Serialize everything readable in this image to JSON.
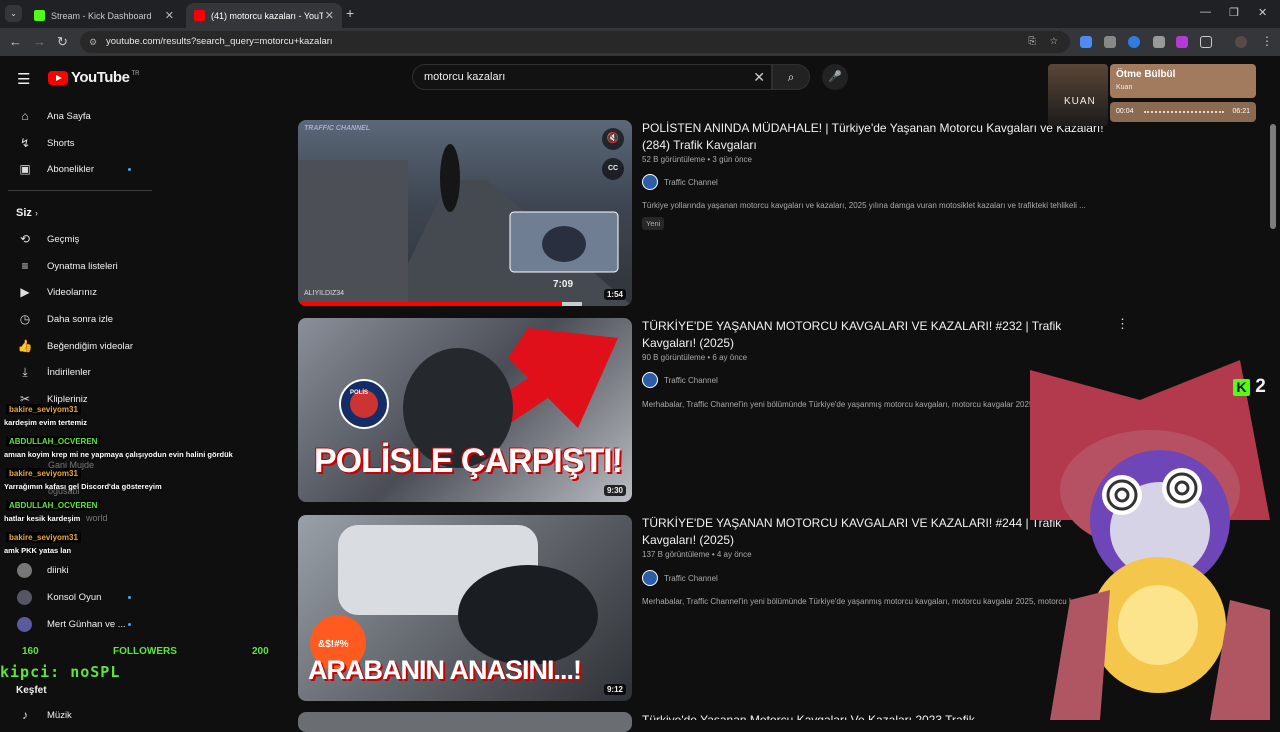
{
  "browser": {
    "tabs": [
      {
        "title": "Stream - Kick Dashboard"
      },
      {
        "title": "(41) motorcu kazaları - YouTube"
      }
    ],
    "url": "youtube.com/results?search_query=motorcu+kazaları"
  },
  "youtube": {
    "logo": "YouTube",
    "logo_suffix": "TR",
    "search_query": "motorcu kazaları",
    "sidebar": {
      "main": [
        {
          "label": "Ana Sayfa",
          "icon": "home-icon"
        },
        {
          "label": "Shorts",
          "icon": "shorts-icon"
        },
        {
          "label": "Abonelikler",
          "icon": "subscriptions-icon"
        }
      ],
      "you_header": "Siz",
      "you": [
        {
          "label": "Geçmiş",
          "icon": "history-icon"
        },
        {
          "label": "Oynatma listeleri",
          "icon": "playlists-icon"
        },
        {
          "label": "Videolarınız",
          "icon": "your-videos-icon"
        },
        {
          "label": "Daha sonra izle",
          "icon": "watch-later-icon"
        },
        {
          "label": "Beğendiğim videolar",
          "icon": "liked-icon"
        },
        {
          "label": "İndirilenler",
          "icon": "downloads-icon"
        },
        {
          "label": "Klipleriniz",
          "icon": "clips-icon"
        }
      ],
      "subs": [
        {
          "label": "diinki"
        },
        {
          "label": "Konsol Oyun"
        },
        {
          "label": "Mert Günhan ve ..."
        }
      ],
      "subs_partial": [
        "Gani Mujde",
        "ogusabi",
        "world"
      ],
      "explore_header": "Keşfet",
      "explore": [
        {
          "label": "Müzik"
        }
      ]
    },
    "results": [
      {
        "title": "POLİSTEN ANINDA MÜDAHALE! | Türkiye'de Yaşanan Motorcu Kavgaları ve Kazaları! (284) Trafik Kavgaları",
        "views": "52 B görüntüleme",
        "age": "3 gün önce",
        "channel": "Traffic Channel",
        "desc": "Türkiye yollarında yaşanan motorcu kavgaları ve kazaları, 2025 yılına damga vuran motosiklet kazaları ve trafikteki tehlikeli ...",
        "badge": "Yeni",
        "duration": "1:54",
        "preview_time": "7:09",
        "thumb_brand": "TRAFFIC CHANNEL",
        "thumb_handle": "ALIYILDIZ34"
      },
      {
        "title": "TÜRKİYE'DE YAŞANAN MOTORCU KAVGALARI VE KAZALARI! #232 | Trafik Kavgaları! (2025)",
        "views": "90 B görüntüleme",
        "age": "6 ay önce",
        "channel": "Traffic Channel",
        "desc": "Merhabalar, Traffic Channel'in yeni bölümünde Türkiye'de yaşanmış motorcu kavgaları, motorcu kavgalar 2025,",
        "duration": "9:30",
        "thumb_text": "POLİSLE ÇARPIŞTI!",
        "thumb_badge": "POLİS"
      },
      {
        "title": "TÜRKİYE'DE YAŞANAN MOTORCU KAVGALARI VE KAZALARI! #244 | Trafik Kavgaları! (2025)",
        "views": "137 B görüntüleme",
        "age": "4 ay önce",
        "channel": "Traffic Channel",
        "desc": "Merhabalar, Traffic Channel'in yeni bölümünde Türkiye'de yaşanmış motorcu kavgaları, motorcu kavgalar 2025, motorcu k",
        "duration": "9:12",
        "thumb_text": "ARABANIN ANASINI...!",
        "thumb_emoji_text": "&$!#%"
      },
      {
        "title": "Türkiye'de Yaşanan Motorcu Kavgaları Ve Kazaları 2023 Trafik"
      }
    ]
  },
  "overlay": {
    "chat": [
      {
        "name": "bakire_seviyom31",
        "msg": "kardeşim evim tertemiz",
        "color": "#f0a830"
      },
      {
        "name": "ABDULLAH_OCVEREN",
        "msg": "amıan koyim krep mi ne yapmaya çalışıyodun evin halini gördük",
        "color": "#5fe43a"
      },
      {
        "name": "bakire_seviyom31",
        "msg": "Yarrağımın kafası gel Discord'da göstereyim",
        "color": "#f0a830"
      },
      {
        "name": "ABDULLAH_OCVEREN",
        "msg": "hatlar kesik kardeşim",
        "color": "#5fe43a"
      },
      {
        "name": "bakire_seviyom31",
        "msg": "amk PKK yatas lan",
        "color": "#f0a830"
      }
    ],
    "followers": {
      "current": "160",
      "label": "FOLLOWERS",
      "goal": "200"
    },
    "ticker": "kipci: noSPL",
    "music": {
      "title": "Ötme Bülbül",
      "artist": "Kuan",
      "cover": "KUAN",
      "elapsed": "00:04",
      "total": "06:21",
      "progress": 0.01
    },
    "kick_count": "2"
  }
}
